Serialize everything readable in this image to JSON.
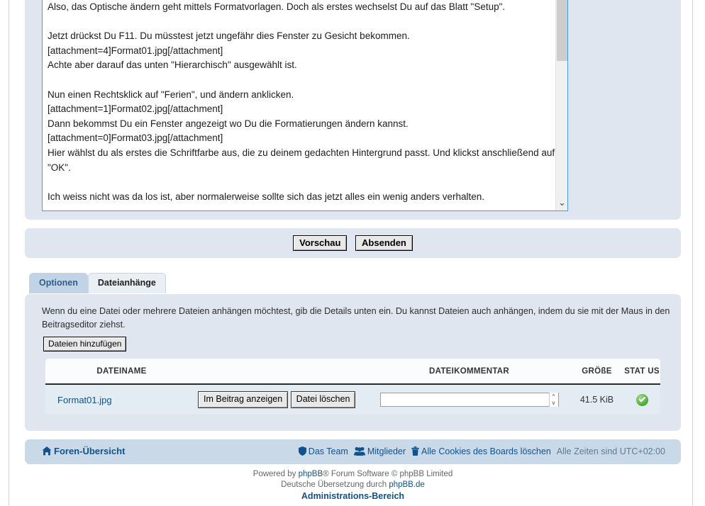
{
  "editor": {
    "message_text": "Also, das Optische ändern geht mittels Formatvorlagen. Doch als erstes wechselst Du auf das Blatt \"Setup\".\n\nJetzt drückst Du F11. Du müsstest jetzt ungefähr dies Fenster zu Gesicht bekommen.\n[attachment=4]Format01.jpg[/attachment]\nAchte aber darauf das unten \"Hierarchisch\" ausgewählt ist.\n\nNun einen Rechtsklick auf \"Ferien\", und ändern anklicken.\n[attachment=1]Format02.jpg[/attachment]\nDann bekommst Du ein Fenster angezeigt wo Du die Formatierungen ändern kannst.\n[attachment=0]Format03.jpg[/attachment]\nHier wählst du als erstes die Schriftfarbe aus, die zu deinem gedachten Hintergrund passt. Und klickst anschließend auf \"OK\".\n\nIch weiss nicht was da los ist, aber normalerweise sollte sich das jetzt alles ein wenig anders verhalten.",
    "scroll_down_glyph": "⌄"
  },
  "submit": {
    "preview_label": "Vorschau",
    "submit_label": "Absenden"
  },
  "tabs": [
    {
      "label": "Optionen",
      "active": false
    },
    {
      "label": "Dateianhänge",
      "active": true
    }
  ],
  "attachments": {
    "explanation": "Wenn du eine Datei oder mehrere Dateien anhängen möchtest, gib die Details unten ein. Du kannst Dateien auch anhängen, indem du sie mit der Maus in den Beitragseditor ziehst.",
    "add_files_label": "Dateien hinzufügen",
    "columns": {
      "filename": "DATEINAME",
      "comment": "DATEIKOMMENTAR",
      "size": "GRÖßE",
      "status": "STAT US"
    },
    "rows": [
      {
        "filename": "Format01.jpg",
        "place_inline_label": "Im Beitrag anzeigen",
        "delete_label": "Datei löschen",
        "comment_value": "",
        "comment_placeholder": "",
        "size": "41.5 KiB",
        "status_icon": "green-check-icon"
      }
    ]
  },
  "footer_nav": {
    "home_label": "Foren-Übersicht",
    "team_label": "Das Team",
    "members_label": "Mitglieder",
    "cookies_label": "Alle Cookies des Boards löschen",
    "times_label": "Alle Zeiten sind UTC+02:00"
  },
  "credits": {
    "line1_prefix": "Powered by ",
    "line1_brand": "phpBB",
    "line1_suffix": "® Forum Software © phpBB Limited",
    "line2_prefix": "Deutsche Übersetzung durch ",
    "line2_brand": "phpBB.de",
    "line3": "Administrations-Bereich"
  },
  "colors": {
    "panel_bg": "#dfe6ef",
    "tab_inactive_bg": "#c2d3e6",
    "tab_active_bg": "#e9eff5",
    "footer_bg": "#c9d9e8",
    "link": "#105289",
    "focus_border": "#3f9ce0",
    "status_green": "#4aa82f",
    "table_row_bg": "#e3ebf3"
  }
}
